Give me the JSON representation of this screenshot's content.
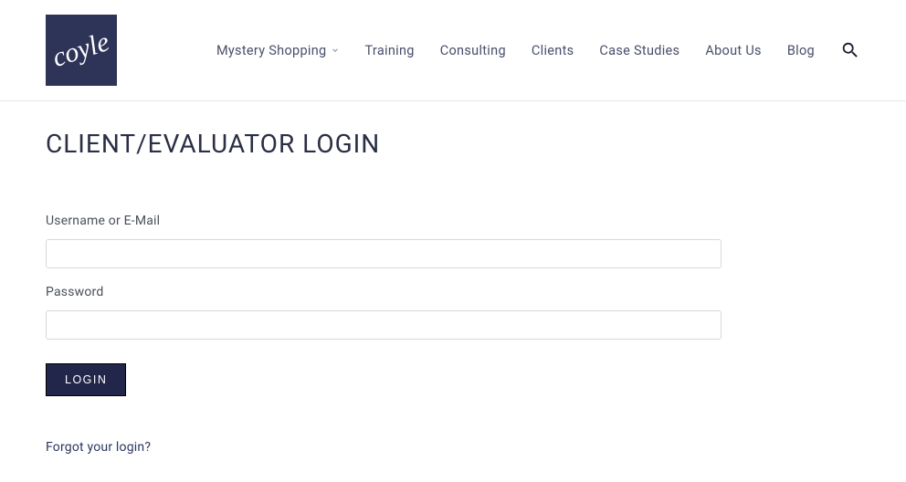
{
  "logo": {
    "text": "coyle"
  },
  "nav": {
    "items": [
      {
        "label": "Mystery Shopping",
        "hasDropdown": true
      },
      {
        "label": "Training",
        "hasDropdown": false
      },
      {
        "label": "Consulting",
        "hasDropdown": false
      },
      {
        "label": "Clients",
        "hasDropdown": false
      },
      {
        "label": "Case Studies",
        "hasDropdown": false
      },
      {
        "label": "About Us",
        "hasDropdown": false
      },
      {
        "label": "Blog",
        "hasDropdown": false
      }
    ]
  },
  "page": {
    "title": "CLIENT/EVALUATOR LOGIN"
  },
  "form": {
    "username_label": "Username or E-Mail",
    "password_label": "Password",
    "login_button": "LOGIN",
    "forgot_link": "Forgot your login?"
  }
}
